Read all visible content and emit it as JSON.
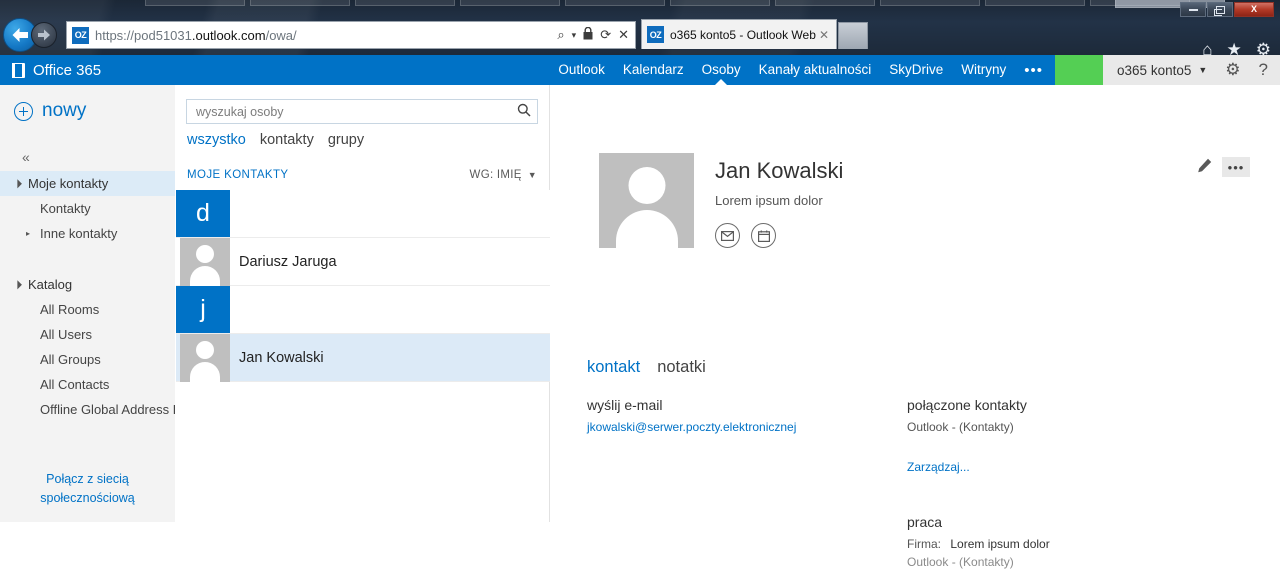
{
  "window": {
    "minimize_label": "minimize",
    "maximize_label": "maximize",
    "close_label": "X"
  },
  "browser": {
    "site_icon_text": "OZ",
    "url_prefix": "https://",
    "url_host_dim": "pod51031",
    "url_host": ".outlook.com",
    "url_path": "/owa/",
    "search_caret": "▾",
    "search_glyph": "⌕",
    "lock_glyph": "🔒",
    "refresh_glyph": "⟳",
    "stop_glyph": "✕",
    "tab_title": "o365 konto5 - Outlook Web...",
    "tab_close": "✕",
    "home_glyph": "⌂",
    "favorites_glyph": "★",
    "settings_glyph": "⚙"
  },
  "suitebar": {
    "brand": "Office 365",
    "links": [
      {
        "label": "Outlook",
        "active": false
      },
      {
        "label": "Kalendarz",
        "active": false
      },
      {
        "label": "Osoby",
        "active": true
      },
      {
        "label": "Kanały aktualności",
        "active": false
      },
      {
        "label": "SkyDrive",
        "active": false
      },
      {
        "label": "Witryny",
        "active": false
      }
    ],
    "overflow": "•••",
    "accent_green": "#54cf54",
    "accent_blue": "#0072c6",
    "user_name": "o365 konto5",
    "user_caret": "▼",
    "gear_glyph": "⚙",
    "help_glyph": "?"
  },
  "sidebar": {
    "new_label": "nowy",
    "collapse_glyph": "«",
    "groups": [
      {
        "root": {
          "label": "Moje kontakty",
          "selected": true,
          "expanded": true
        },
        "children": [
          {
            "label": "Kontakty",
            "expandable": false
          },
          {
            "label": "Inne kontakty",
            "expandable": true
          }
        ]
      },
      {
        "root": {
          "label": "Katalog",
          "selected": false,
          "expanded": true
        },
        "children": [
          {
            "label": "All Rooms",
            "expandable": false
          },
          {
            "label": "All Users",
            "expandable": false
          },
          {
            "label": "All Groups",
            "expandable": false
          },
          {
            "label": "All Contacts",
            "expandable": false
          },
          {
            "label": "Offline Global Address List",
            "expandable": false
          }
        ]
      }
    ],
    "social_link_line1": "Połącz z siecią",
    "social_link_line2": "społecznościową"
  },
  "list": {
    "search_placeholder": "wyszukaj osoby",
    "search_value": "",
    "search_icon": "⌕",
    "filters": [
      {
        "label": "wszystko",
        "active": true
      },
      {
        "label": "kontakty",
        "active": false
      },
      {
        "label": "grupy",
        "active": false
      }
    ],
    "folder_title": "MOJE KONTAKTY",
    "sort_label": "WG: IMIĘ",
    "sort_caret": "▼",
    "rows": [
      {
        "type": "group",
        "badge": "d"
      },
      {
        "type": "contact",
        "name": "Dariusz Jaruga",
        "selected": false
      },
      {
        "type": "group",
        "badge": "j"
      },
      {
        "type": "contact",
        "name": "Jan Kowalski",
        "selected": true
      }
    ]
  },
  "detail": {
    "edit_icon": "✎",
    "more_label": "•••",
    "name": "Jan Kowalski",
    "subtitle": "Lorem ipsum dolor",
    "quick_actions": [
      {
        "icon": "mail-icon",
        "glyph": "✉"
      },
      {
        "icon": "calendar-icon",
        "glyph": "Ὄ5"
      }
    ],
    "tabs": [
      {
        "label": "kontakt",
        "active": true
      },
      {
        "label": "notatki",
        "active": false
      }
    ],
    "left_column": {
      "email_heading": "wyślij e-mail",
      "email_address": "jkowalski@serwer.poczty.elektronicznej"
    },
    "right_column": {
      "linked_heading": "połączone kontakty",
      "linked_source": "Outlook - (Kontakty)",
      "manage_link": "Zarządzaj...",
      "work_heading": "praca",
      "work_company_label": "Firma:",
      "work_company_value": "Lorem ipsum dolor",
      "work_source": "Outlook - (Kontakty)"
    }
  }
}
